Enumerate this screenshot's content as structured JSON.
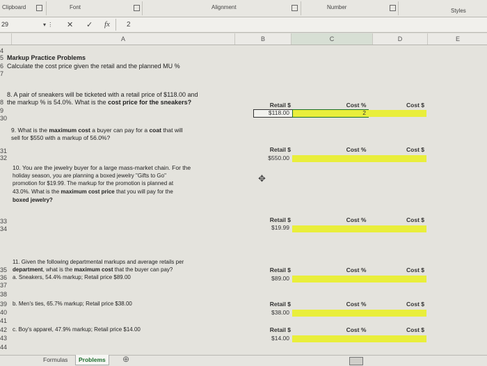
{
  "ribbon": {
    "groups": [
      "Clipboard",
      "Font",
      "Alignment",
      "Number",
      "Styles"
    ]
  },
  "formula_bar": {
    "name_box": "29",
    "cancel": "✕",
    "enter": "✓",
    "fx": "fx",
    "value": "2"
  },
  "columns": [
    "A",
    "B",
    "C",
    "D",
    "E"
  ],
  "rows": {
    "r4": "4",
    "r5": "5",
    "r6": "6",
    "r7": "7",
    "r8": "8",
    "r9": "9",
    "r30": "30",
    "r31": "31",
    "r32": "32",
    "r33": "33",
    "r34": "34",
    "r35": "35",
    "r36": "36",
    "r37": "37",
    "r38": "38",
    "r39": "39",
    "r40": "40",
    "r41": "41",
    "r42": "42",
    "r43": "43",
    "r44": "44"
  },
  "content": {
    "title": "Markup Practice Problems",
    "subtitle": "Calculate the cost price given the retail and the planned MU %",
    "q8_line1": "8. A pair of sneakers will be ticketed with a retail price of $118.00 and",
    "q8_line2_a": "the markup % is 54.0%. What is the ",
    "q8_line2_b": "cost price for the sneakers?",
    "q9_line1_a": "9. What is the ",
    "q9_line1_b": "maximum cost",
    "q9_line1_c": " a buyer can pay for a ",
    "q9_line1_d": "coat",
    "q9_line1_e": " that will",
    "q9_line2": "sell for $550 with a markup of 56.0%?",
    "q10_line1": "10. You are the jewelry buyer for a large mass-market chain. For the",
    "q10_line2": "holiday season, you are planning a boxed jewelry \"Gifts to Go\"",
    "q10_line3": "promotion for $19.99. The markup for the promotion is planned at",
    "q10_line4_a": "43.0%. What is the ",
    "q10_line4_b": "maximum cost price",
    "q10_line4_c": " that you will pay for the",
    "q10_line5": "boxed jewelry?",
    "q11_line1": "11. Given the following departmental markups and average retails per",
    "q11_line2_a": "department",
    "q11_line2_b": ", what is the ",
    "q11_line2_c": "maximum cost",
    "q11_line2_d": " that the buyer can pay?",
    "q11a": "a. Sneakers, 54.4% markup; Retail price $89.00",
    "q11b": "b. Men's ties, 65.7% markup; Retail price $38.00",
    "q11c": "c. Boy's apparel, 47.9% markup; Retail price $14.00"
  },
  "answers": {
    "retail_label": "Retail $",
    "cost_pct_label": "Cost %",
    "cost_label": "Cost $",
    "retail_values": [
      "$118.00",
      "$550.00",
      "$19.99",
      "$89.00",
      "$38.00",
      "$14.00"
    ],
    "selected_value": "2"
  },
  "sheet_tabs": {
    "tab1": "Formulas",
    "tab2": "Problems"
  },
  "colors": {
    "highlight": "#e9ee3b",
    "selection": "#1d6f2e"
  }
}
